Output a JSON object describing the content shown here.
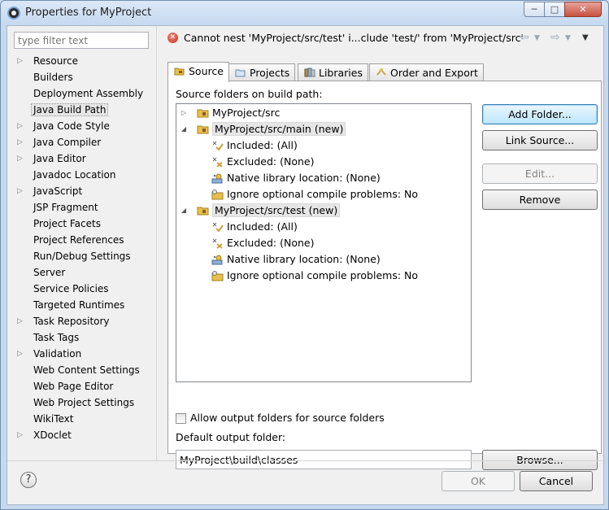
{
  "window": {
    "title": "Properties for MyProject"
  },
  "filter": {
    "placeholder": "type filter text"
  },
  "nav": [
    {
      "label": "Resource",
      "expandable": true
    },
    {
      "label": "Builders",
      "expandable": false
    },
    {
      "label": "Deployment Assembly",
      "expandable": false
    },
    {
      "label": "Java Build Path",
      "expandable": false,
      "selected": true
    },
    {
      "label": "Java Code Style",
      "expandable": true
    },
    {
      "label": "Java Compiler",
      "expandable": true
    },
    {
      "label": "Java Editor",
      "expandable": true
    },
    {
      "label": "Javadoc Location",
      "expandable": false
    },
    {
      "label": "JavaScript",
      "expandable": true
    },
    {
      "label": "JSP Fragment",
      "expandable": false
    },
    {
      "label": "Project Facets",
      "expandable": false
    },
    {
      "label": "Project References",
      "expandable": false
    },
    {
      "label": "Run/Debug Settings",
      "expandable": false
    },
    {
      "label": "Server",
      "expandable": false
    },
    {
      "label": "Service Policies",
      "expandable": false
    },
    {
      "label": "Targeted Runtimes",
      "expandable": false
    },
    {
      "label": "Task Repository",
      "expandable": true
    },
    {
      "label": "Task Tags",
      "expandable": false
    },
    {
      "label": "Validation",
      "expandable": true
    },
    {
      "label": "Web Content Settings",
      "expandable": false
    },
    {
      "label": "Web Page Editor",
      "expandable": false
    },
    {
      "label": "Web Project Settings",
      "expandable": false
    },
    {
      "label": "WikiText",
      "expandable": false
    },
    {
      "label": "XDoclet",
      "expandable": true
    }
  ],
  "message": {
    "icon": "error-icon",
    "text": "Cannot nest 'MyProject/src/test' i...clude 'test/' from 'MyProject/src'"
  },
  "tabs": [
    {
      "label": "Source",
      "icon": "source-folder-icon",
      "active": true
    },
    {
      "label": "Projects",
      "icon": "projects-icon",
      "active": false
    },
    {
      "label": "Libraries",
      "icon": "libraries-icon",
      "active": false
    },
    {
      "label": "Order and Export",
      "icon": "order-export-icon",
      "active": false
    }
  ],
  "source": {
    "heading": "Source folders on build path:",
    "tree": [
      {
        "label": "MyProject/src",
        "level": 0,
        "toggle": "collapsed",
        "icon": "source-folder-icon"
      },
      {
        "label": "MyProject/src/main (new)",
        "level": 0,
        "toggle": "expanded",
        "icon": "source-folder-icon",
        "highlight": true
      },
      {
        "label": "Included: (All)",
        "level": 1,
        "icon": "inclusion-filter-icon"
      },
      {
        "label": "Excluded: (None)",
        "level": 1,
        "icon": "exclusion-filter-icon"
      },
      {
        "label": "Native library location: (None)",
        "level": 1,
        "icon": "native-library-icon"
      },
      {
        "label": "Ignore optional compile problems: No",
        "level": 1,
        "icon": "ignore-problems-icon"
      },
      {
        "label": "MyProject/src/test (new)",
        "level": 0,
        "toggle": "expanded",
        "icon": "source-folder-icon",
        "highlight": true
      },
      {
        "label": "Included: (All)",
        "level": 1,
        "icon": "inclusion-filter-icon"
      },
      {
        "label": "Excluded: (None)",
        "level": 1,
        "icon": "exclusion-filter-icon"
      },
      {
        "label": "Native library location: (None)",
        "level": 1,
        "icon": "native-library-icon"
      },
      {
        "label": "Ignore optional compile problems: No",
        "level": 1,
        "icon": "ignore-problems-icon"
      }
    ],
    "buttons": {
      "add_folder": "Add Folder...",
      "link_source": "Link Source...",
      "edit": "Edit...",
      "remove": "Remove"
    },
    "allow_output_label": "Allow output folders for source folders",
    "allow_output_checked": false,
    "default_output_label": "Default output folder:",
    "default_output_value": "MyProject\\build\\classes",
    "browse_label": "Browse..."
  },
  "footer": {
    "ok_label": "OK",
    "cancel_label": "Cancel",
    "help_symbol": "?"
  },
  "colors": {
    "error": "#c62d1c",
    "folder": "#e8c04a",
    "selection": "#e6e6e6",
    "default_button": "#3c7fb1"
  }
}
